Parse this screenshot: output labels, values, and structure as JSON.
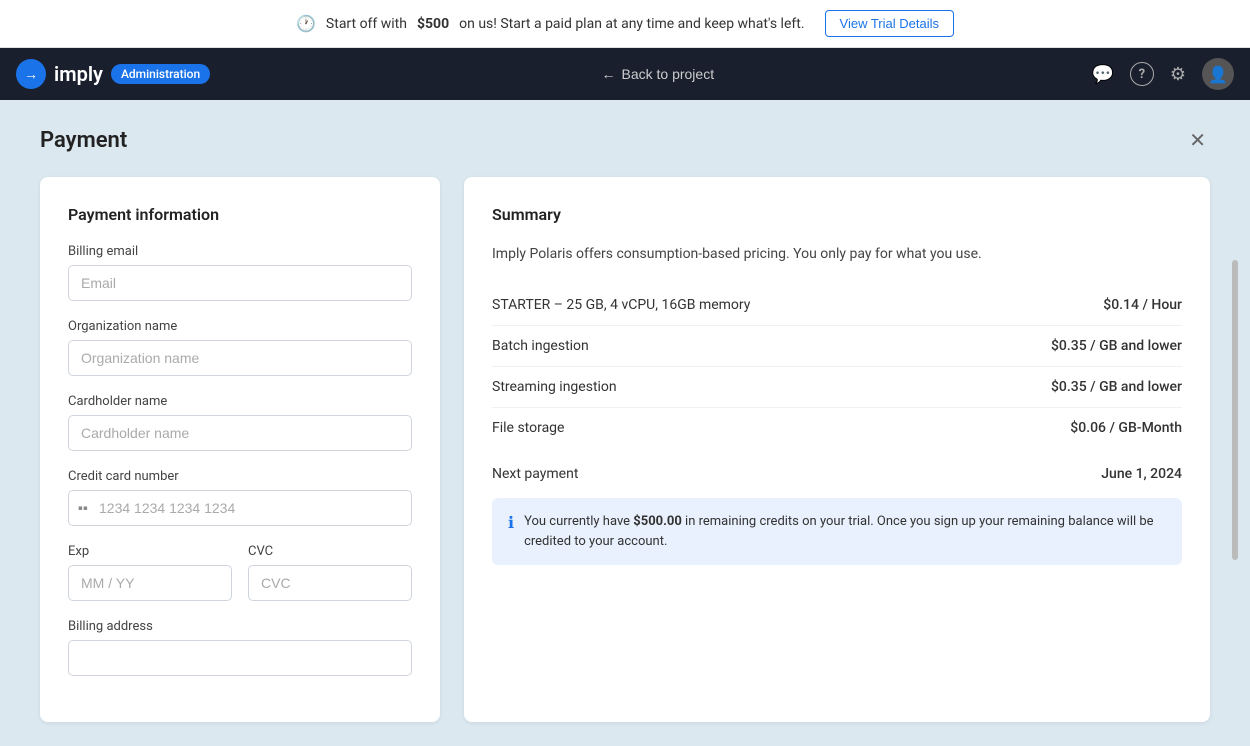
{
  "banner": {
    "message_pre": "Start off with ",
    "bold_amount": "$500",
    "message_post": " on us! Start a paid plan at any time and keep what's left.",
    "button_label": "View Trial Details",
    "clock_symbol": "🕐"
  },
  "navbar": {
    "logo_text": "imply",
    "admin_badge": "Administration",
    "back_label": "Back to project",
    "icons": {
      "chat": "💬",
      "help": "?",
      "settings": "⚙",
      "user": "👤"
    }
  },
  "page": {
    "title": "Payment",
    "close_symbol": "✕"
  },
  "payment_form": {
    "section_title": "Payment information",
    "billing_email_label": "Billing email",
    "billing_email_placeholder": "Email",
    "billing_email_value": "",
    "org_name_label": "Organization name",
    "org_name_placeholder": "Organization name",
    "org_name_value": "",
    "cardholder_label": "Cardholder name",
    "cardholder_placeholder": "Cardholder name",
    "cardholder_value": "",
    "cc_label": "Credit card number",
    "cc_placeholder": "1234 1234 1234 1234",
    "cc_value": "",
    "cc_icon": "▪",
    "exp_label": "Exp",
    "exp_placeholder": "MM / YY",
    "exp_value": "",
    "cvc_label": "CVC",
    "cvc_placeholder": "CVC",
    "cvc_value": "",
    "billing_address_label": "Billing address",
    "billing_address_placeholder": "",
    "billing_address_value": ""
  },
  "summary": {
    "section_title": "Summary",
    "description": "Imply Polaris offers consumption-based pricing. You only pay for what you use.",
    "rows": [
      {
        "label": "STARTER – 25 GB, 4 vCPU, 16GB memory",
        "value": "$0.14 / Hour"
      },
      {
        "label": "Batch ingestion",
        "value": "$0.35 / GB and lower"
      },
      {
        "label": "Streaming ingestion",
        "value": "$0.35 / GB and lower"
      },
      {
        "label": "File storage",
        "value": "$0.06 / GB-Month"
      }
    ],
    "next_payment_label": "Next payment",
    "next_payment_value": "June 1, 2024",
    "info_icon": "ℹ",
    "info_text_pre": "You currently have ",
    "info_bold": "$500.00",
    "info_text_post": " in remaining credits on your trial. Once you sign up your remaining balance will be credited to your account."
  }
}
